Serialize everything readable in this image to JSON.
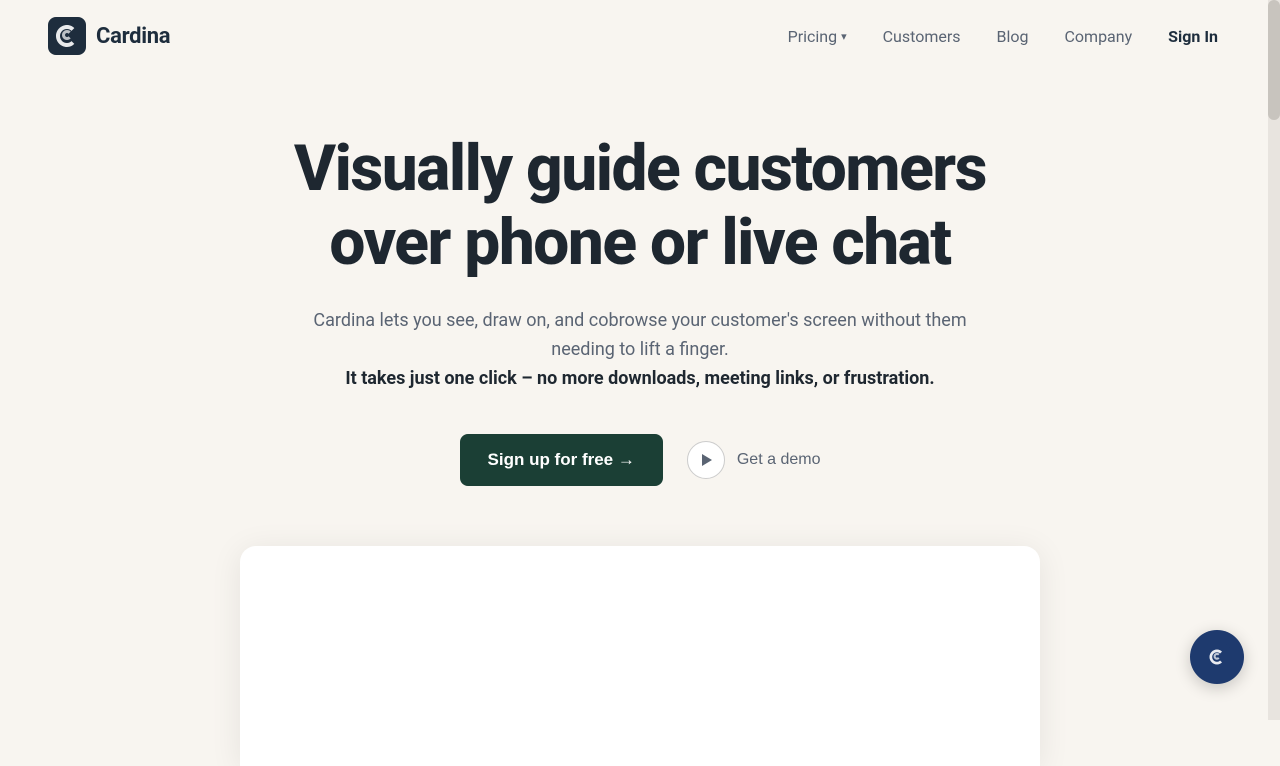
{
  "brand": {
    "name": "Cardina",
    "logo_alt": "Cardina logo"
  },
  "nav": {
    "links": [
      {
        "id": "pricing",
        "label": "Pricing",
        "has_dropdown": true
      },
      {
        "id": "customers",
        "label": "Customers",
        "has_dropdown": false
      },
      {
        "id": "blog",
        "label": "Blog",
        "has_dropdown": false
      },
      {
        "id": "company",
        "label": "Company",
        "has_dropdown": false
      }
    ],
    "signin_label": "Sign In"
  },
  "hero": {
    "title_line1": "Visually guide customers",
    "title_line2": "over phone or live chat",
    "description": "Cardina lets you see, draw on, and cobrowse your customer's screen without them needing to lift a finger.",
    "description_bold": "It takes just one click – no more downloads, meeting links, or frustration.",
    "cta_primary": "Sign up for free →",
    "cta_demo": "Get a demo"
  },
  "colors": {
    "bg": "#f8f5f0",
    "primary_btn": "#1b3f35",
    "logo_text": "#1e2d3d",
    "nav_text": "#5a6473",
    "hero_title": "#1e2730",
    "hero_desc": "#5a6473",
    "chat_btn": "#1e3a6e"
  }
}
